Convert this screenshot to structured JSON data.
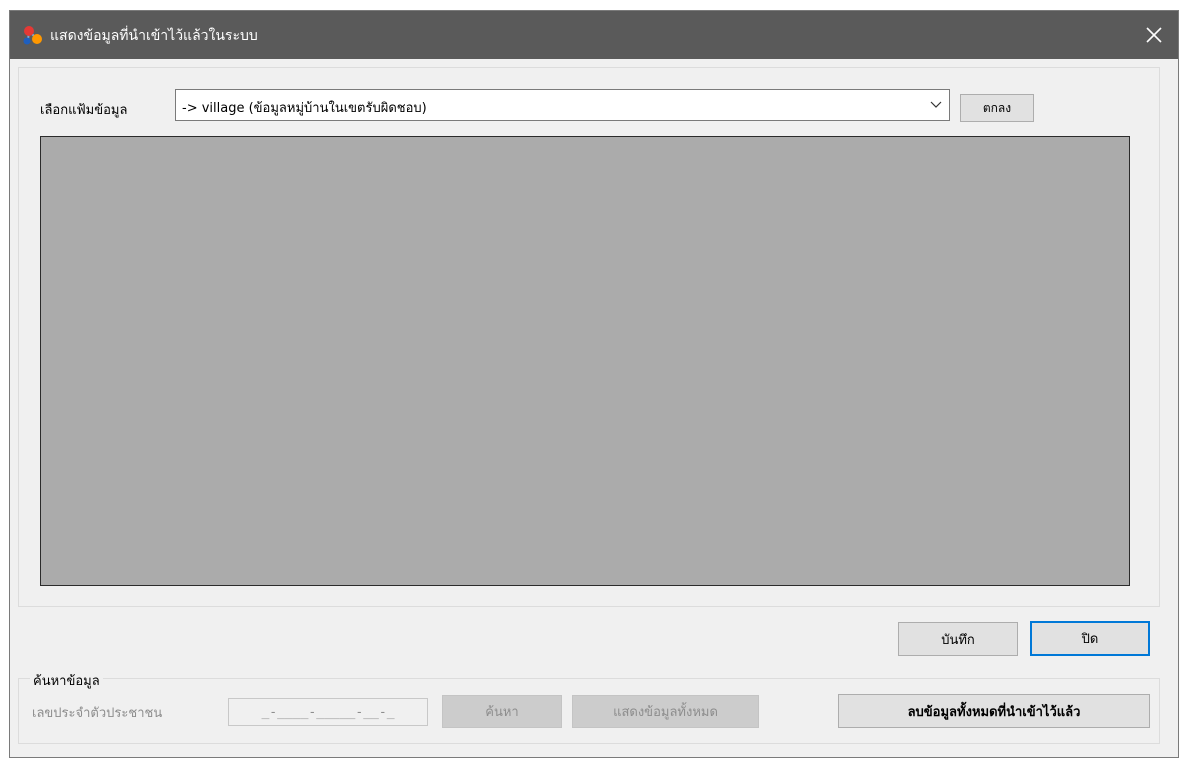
{
  "window": {
    "title": "แสดงข้อมูลที่นำเข้าไว้แล้วในระบบ",
    "icons": {
      "app": "molecule-app-icon",
      "close": "close-icon"
    }
  },
  "file_select": {
    "label": "เลือกแฟ้มข้อมูล",
    "selected_value": "-> village (ข้อมูลหมู่บ้านในเขตรับผิดชอบ)",
    "ok_button": "ตกลง"
  },
  "grid": {
    "background": "#ababab"
  },
  "actions": {
    "save_button": "บันทึก",
    "close_button": "ปิด"
  },
  "search": {
    "group_title": "ค้นหาข้อมูล",
    "id_label": "เลขประจำตัวประชาชน",
    "id_mask": "_-____-_____-__-_",
    "search_button": "ค้นหา",
    "show_all_button": "แสดงข้อมูลทั้งหมด",
    "delete_all_button": "ลบข้อมูลทั้งหมดที่นำเข้าไว้แล้ว"
  },
  "colors": {
    "titlebar": "#5a5a5a",
    "window_bg": "#f0f0f0",
    "focus_border": "#0078d7",
    "disabled_text": "#8d8d8d"
  }
}
